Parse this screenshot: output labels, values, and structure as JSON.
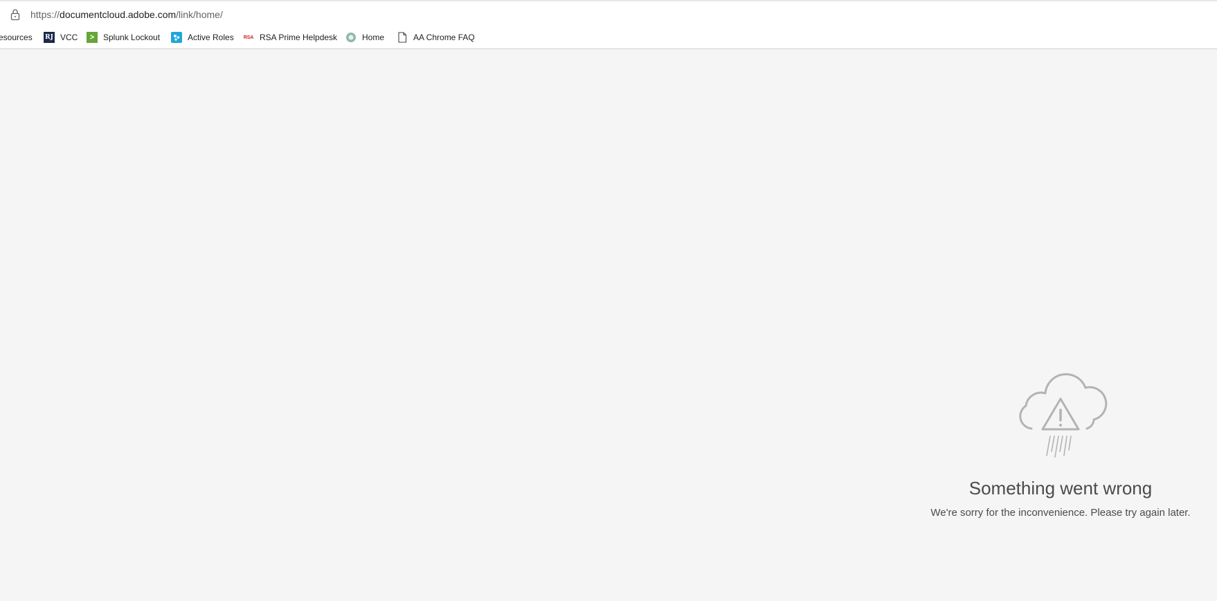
{
  "browser": {
    "address_bar": {
      "url_scheme": "https://",
      "url_host": "documentcloud.adobe.com",
      "url_path": "/link/home/"
    },
    "bookmarks": [
      {
        "label": "esources",
        "icon": "none"
      },
      {
        "label": "VCC",
        "icon": "rj-logo-icon"
      },
      {
        "label": "Splunk Lockout",
        "icon": "splunk-icon"
      },
      {
        "label": "Active Roles",
        "icon": "active-roles-icon"
      },
      {
        "label": "RSA Prime Helpdesk",
        "icon": "rsa-icon"
      },
      {
        "label": "Home",
        "icon": "globe-icon"
      },
      {
        "label": "AA Chrome FAQ",
        "icon": "document-icon"
      }
    ],
    "icon_text": {
      "rj": "RJ",
      "splunk": ">",
      "rsa": "RSA"
    }
  },
  "error": {
    "icon": "cloud-warning-rain-icon",
    "title": "Something went wrong",
    "message": "We're sorry for the inconvenience. Please try again later."
  },
  "colors": {
    "background": "#f5f5f5",
    "text": "#4b4b4b",
    "icon_stroke": "#b3b3b3"
  }
}
